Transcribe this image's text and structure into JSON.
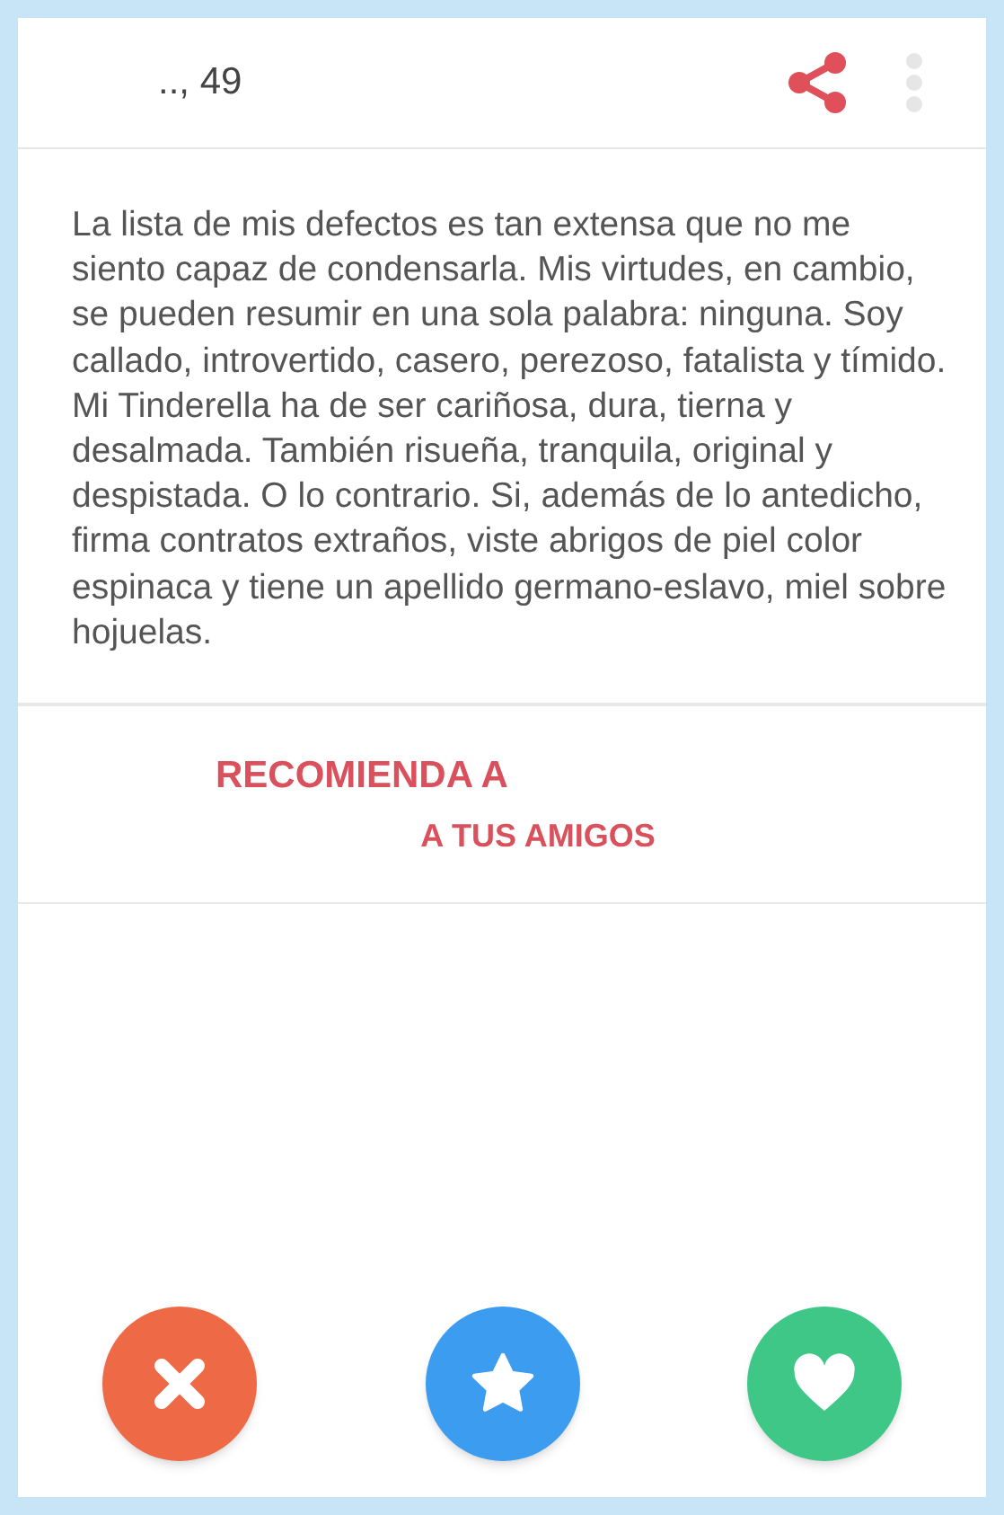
{
  "header": {
    "name_age": ".., 49"
  },
  "bio": "La lista de mis defectos es tan extensa que no me siento capaz de condensarla. Mis virtudes, en cambio, se pueden resumir en una sola palabra: ninguna. Soy callado, introvertido, casero, perezoso, fatalista y tímido. Mi Tinderella ha de ser cariñosa, dura, tierna y desalmada. También risueña, tranquila, original y despistada. O lo contrario. Si, además de lo antedicho, firma contratos extraños, viste abrigos de piel color espinaca y tiene un apellido germano-eslavo, miel sobre hojuelas.",
  "recommend": {
    "line_1": "RECOMIENDA A",
    "line_2": "A TUS AMIGOS"
  },
  "actions": [
    {
      "kind": "nope",
      "color": "#ee6a47"
    },
    {
      "kind": "superlike",
      "color": "#3b9cf0"
    },
    {
      "kind": "like",
      "color": "#3ec787"
    }
  ]
}
